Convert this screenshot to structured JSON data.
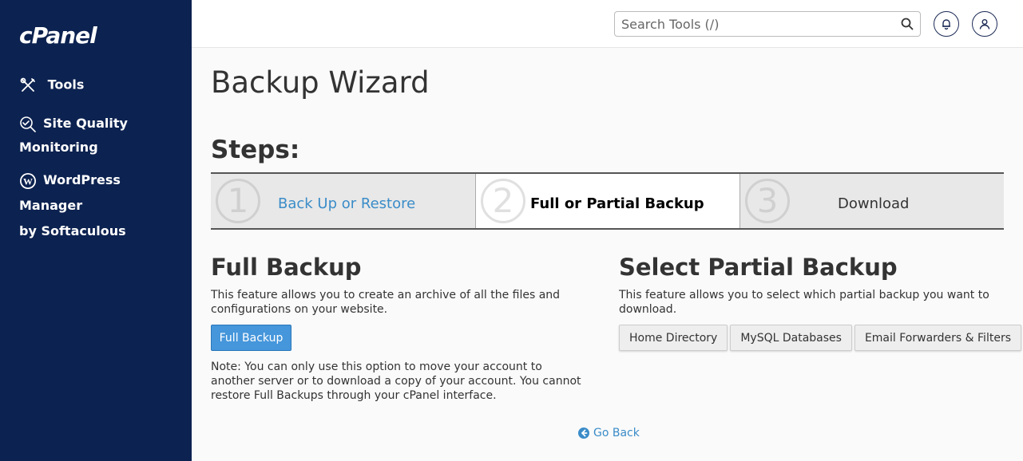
{
  "sidebar": {
    "logo": "cPanel",
    "items": [
      {
        "label": "Tools",
        "icon": "tools-icon"
      },
      {
        "label_line1": "Site Quality",
        "label_line2": "Monitoring",
        "icon": "site-quality-icon"
      },
      {
        "label_line1": "WordPress Manager",
        "label_line2": "by Softaculous",
        "icon": "wordpress-icon"
      }
    ]
  },
  "header": {
    "search_placeholder": "Search Tools (/)"
  },
  "main": {
    "title": "Backup Wizard",
    "steps_title": "Steps:",
    "steps": [
      {
        "num": "1",
        "label": "Back Up or Restore",
        "state": "link"
      },
      {
        "num": "2",
        "label": "Full or Partial Backup",
        "state": "current"
      },
      {
        "num": "3",
        "label": "Download",
        "state": "upcoming"
      }
    ],
    "full_backup": {
      "title": "Full Backup",
      "description": "This feature allows you to create an archive of all the files and configurations on your website.",
      "button": "Full Backup",
      "note": "Note: You can only use this option to move your account to another server or to download a copy of your account. You cannot restore Full Backups through your cPanel interface."
    },
    "partial_backup": {
      "title": "Select Partial Backup",
      "description": "This feature allows you to select which partial backup you want to download.",
      "buttons": [
        "Home Directory",
        "MySQL Databases",
        "Email Forwarders & Filters"
      ]
    },
    "go_back": "Go Back"
  },
  "colors": {
    "sidebar_bg": "#0c2250",
    "accent": "#4596db",
    "link": "#3a8cc8"
  }
}
